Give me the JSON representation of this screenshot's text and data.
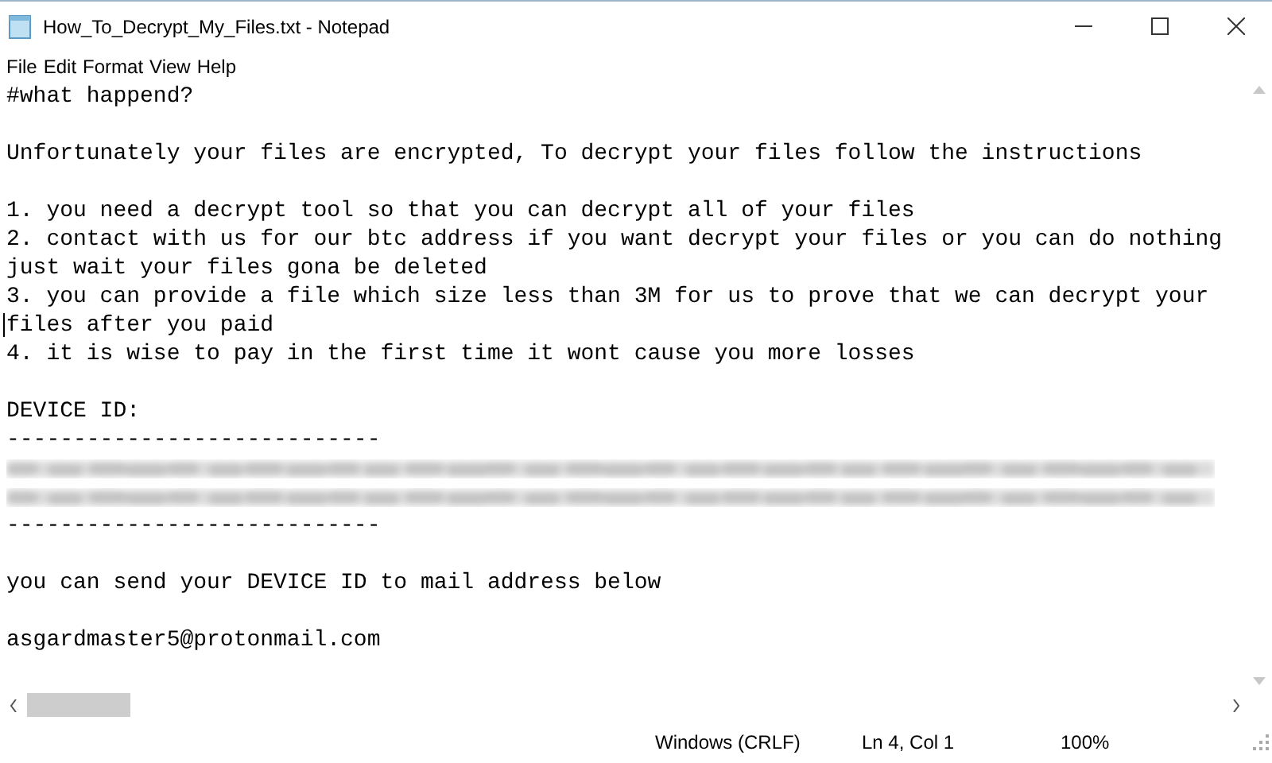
{
  "window": {
    "title": "How_To_Decrypt_My_Files.txt - Notepad"
  },
  "menu": [
    "File",
    "Edit",
    "Format",
    "View",
    "Help"
  ],
  "lines": [
    {
      "kind": "text",
      "text": "#what happend?",
      "caret": false
    },
    {
      "kind": "blank"
    },
    {
      "kind": "text",
      "text": "Unfortunately your files are encrypted, To decrypt your files follow the instructions",
      "caret": false
    },
    {
      "kind": "blank"
    },
    {
      "kind": "text",
      "text": "1. you need a decrypt tool so that you can decrypt all of your files",
      "caret": false
    },
    {
      "kind": "text",
      "text": "2. contact with us for our btc address if you want decrypt your files or you can do nothing",
      "caret": false
    },
    {
      "kind": "text",
      "text": "just wait your files gona be deleted",
      "caret": false
    },
    {
      "kind": "text",
      "text": "3. you can provide a file which size less than 3M for us to prove that we can decrypt your",
      "caret": false
    },
    {
      "kind": "text",
      "text": "files after you paid",
      "caret": true
    },
    {
      "kind": "text",
      "text": "4. it is wise to pay in the first time it wont cause you more losses",
      "caret": false
    },
    {
      "kind": "blank"
    },
    {
      "kind": "text",
      "text": "DEVICE ID:",
      "caret": false
    },
    {
      "kind": "text",
      "text": "----------------------------",
      "caret": false
    },
    {
      "kind": "redacted"
    },
    {
      "kind": "redacted"
    },
    {
      "kind": "text",
      "text": "----------------------------",
      "caret": false
    },
    {
      "kind": "blank"
    },
    {
      "kind": "text",
      "text": "you can send your DEVICE ID to mail address below",
      "caret": false
    },
    {
      "kind": "blank"
    },
    {
      "kind": "text",
      "text": "asgardmaster5@protonmail.com",
      "caret": false
    }
  ],
  "status_bar": [
    "Windows (CRLF)",
    "Ln 4, Col 1",
    "100%"
  ]
}
